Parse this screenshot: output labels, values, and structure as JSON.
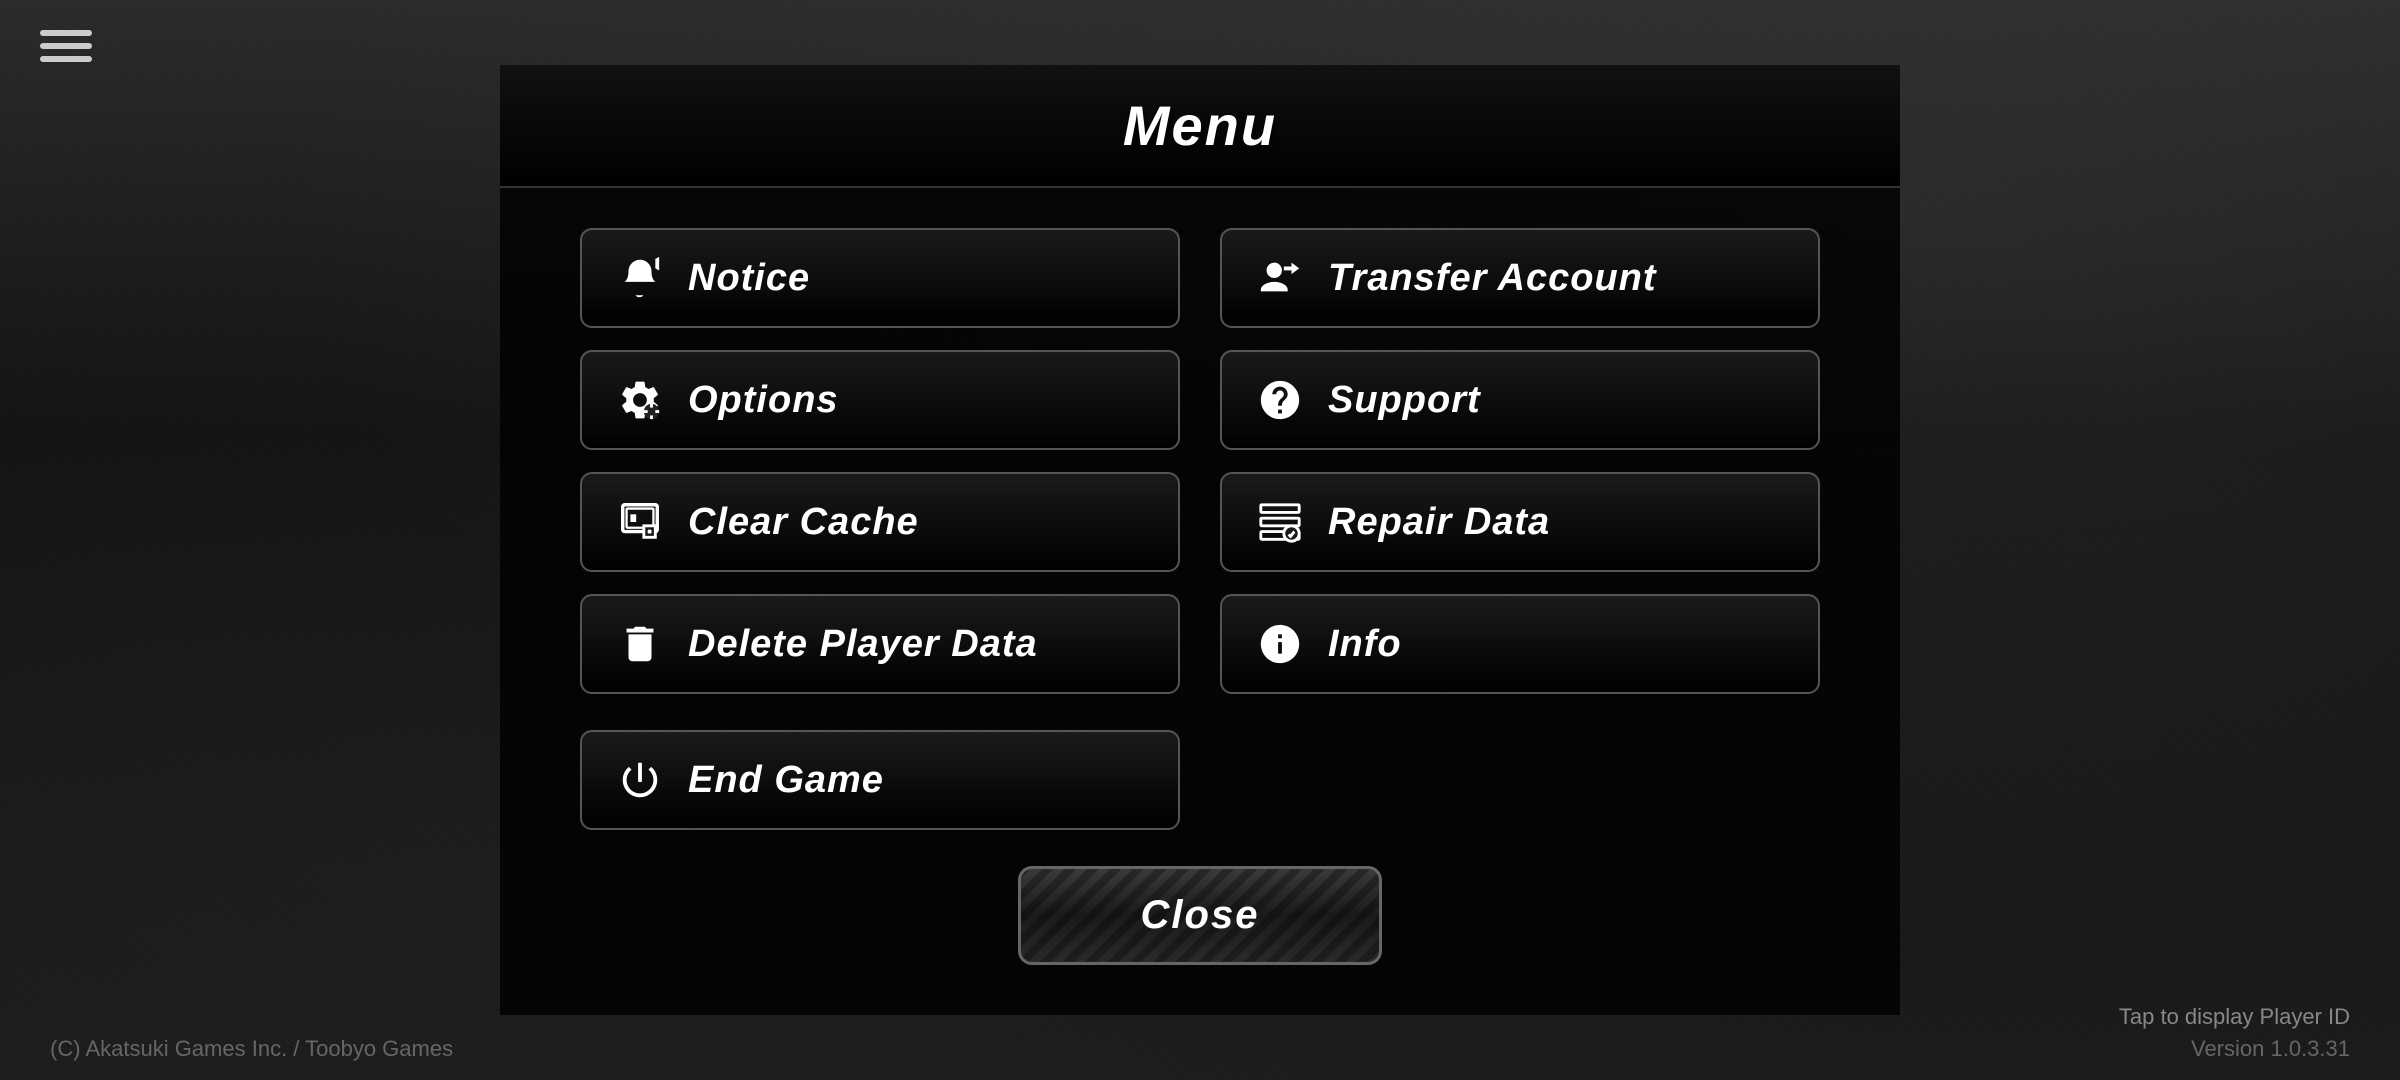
{
  "app": {
    "title": "Menu",
    "hamburger_label": "≡"
  },
  "menu": {
    "title": "Menu",
    "buttons_left": [
      {
        "id": "notice",
        "label": "Notice",
        "icon": "megaphone"
      },
      {
        "id": "options",
        "label": "Options",
        "icon": "gear"
      },
      {
        "id": "clear-cache",
        "label": "Clear Cache",
        "icon": "clear-cache"
      },
      {
        "id": "delete-player-data",
        "label": "Delete Player Data",
        "icon": "trash"
      }
    ],
    "buttons_right": [
      {
        "id": "transfer-account",
        "label": "Transfer Account",
        "icon": "transfer"
      },
      {
        "id": "support",
        "label": "Support",
        "icon": "help"
      },
      {
        "id": "repair-data",
        "label": "Repair Data",
        "icon": "repair"
      },
      {
        "id": "info",
        "label": "Info",
        "icon": "info"
      }
    ],
    "end_game": {
      "label": "End Game",
      "icon": "power"
    },
    "close": {
      "label": "Close"
    }
  },
  "footer": {
    "copyright": "(C) Akatsuki Games Inc. / Toobyo Games",
    "tap_display": "Tap to display Player ID",
    "version": "Version 1.0.3.31"
  }
}
